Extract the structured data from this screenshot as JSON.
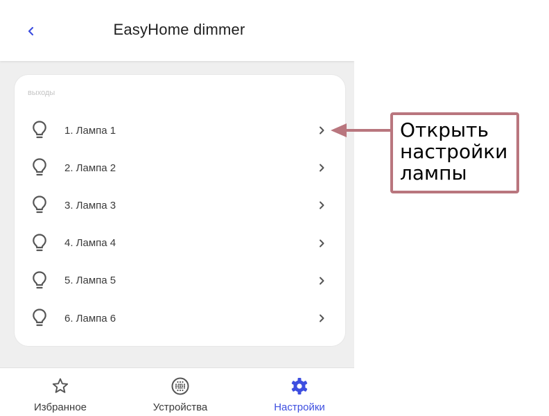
{
  "header": {
    "title": "EasyHome dimmer",
    "back_icon": "chevron-left-icon",
    "accent_color": "#3d4ee0"
  },
  "outputs": {
    "section_label": "выходы",
    "items": [
      {
        "label": "1. Лампа 1",
        "icon": "lightbulb-icon"
      },
      {
        "label": "2. Лампа 2",
        "icon": "lightbulb-icon"
      },
      {
        "label": "3. Лампа 3",
        "icon": "lightbulb-icon"
      },
      {
        "label": "4. Лампа 4",
        "icon": "lightbulb-icon"
      },
      {
        "label": "5. Лампа 5",
        "icon": "lightbulb-icon"
      },
      {
        "label": "6. Лампа 6",
        "icon": "lightbulb-icon"
      }
    ]
  },
  "bottom_nav": {
    "items": [
      {
        "label": "Избранное",
        "icon": "star-icon",
        "active": false
      },
      {
        "label": "Устройства",
        "icon": "devices-grid-icon",
        "active": false
      },
      {
        "label": "Настройки",
        "icon": "gear-icon",
        "active": true
      }
    ]
  },
  "annotation": {
    "text": "Открыть\nнастройки\nлампы",
    "border_color": "#b9767e"
  }
}
